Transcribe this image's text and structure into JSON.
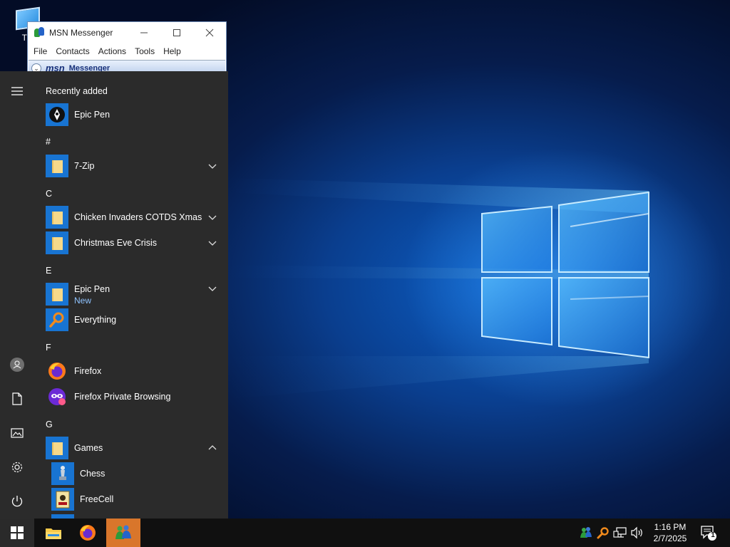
{
  "desktop": {
    "icon_label": "This PC",
    "icon_label_visible": "Thi"
  },
  "msn_window": {
    "title": "MSN Messenger",
    "menu": [
      "File",
      "Contacts",
      "Actions",
      "Tools",
      "Help"
    ],
    "banner_logo": "msn",
    "banner_text": "Messenger"
  },
  "start_menu": {
    "recently_added_title": "Recently added",
    "recently_added": [
      {
        "label": "Epic Pen",
        "icon": "epic-pen-icon"
      }
    ],
    "sections": [
      {
        "letter": "#",
        "items": [
          {
            "label": "7-Zip",
            "icon": "folder-icon",
            "expandable": true
          }
        ]
      },
      {
        "letter": "C",
        "items": [
          {
            "label": "Chicken Invaders COTDS Xmas",
            "icon": "folder-icon",
            "expandable": true
          },
          {
            "label": "Christmas Eve Crisis",
            "icon": "folder-icon",
            "expandable": true
          }
        ]
      },
      {
        "letter": "E",
        "items": [
          {
            "label": "Epic Pen",
            "sublabel": "New",
            "icon": "folder-icon",
            "expandable": true
          },
          {
            "label": "Everything",
            "icon": "everything-search-icon"
          }
        ]
      },
      {
        "letter": "F",
        "items": [
          {
            "label": "Firefox",
            "icon": "firefox-icon"
          },
          {
            "label": "Firefox Private Browsing",
            "icon": "firefox-private-icon"
          }
        ]
      },
      {
        "letter": "G",
        "items": [
          {
            "label": "Games",
            "icon": "folder-icon",
            "expanded": true
          },
          {
            "label": "Chess",
            "icon": "chess-icon"
          },
          {
            "label": "FreeCell",
            "icon": "freecell-icon"
          }
        ]
      }
    ],
    "rail": [
      "hamburger-menu-icon",
      "user-avatar-icon",
      "documents-icon",
      "pictures-icon",
      "settings-gear-icon",
      "power-icon"
    ]
  },
  "taskbar": {
    "pinned": [
      "windows-start-icon",
      "file-explorer-icon",
      "firefox-icon",
      "msn-messenger-icon"
    ],
    "tray": [
      "msn-tray-icon",
      "everything-tray-icon",
      "network-icon",
      "volume-icon"
    ],
    "time": "1:16 PM",
    "date": "2/7/2025",
    "notification_count": "1"
  },
  "colors": {
    "start_bg": "#2b2b2b",
    "tile_blue": "#1874d2",
    "accent_orange": "#d9762b",
    "taskbar_bg": "#101010"
  }
}
